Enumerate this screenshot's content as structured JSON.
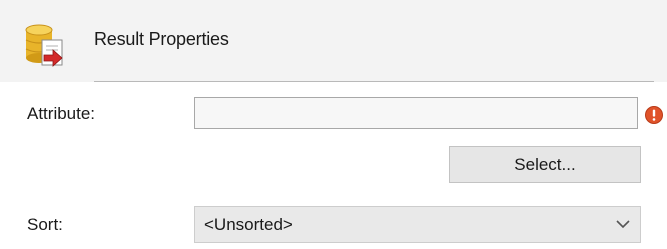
{
  "header": {
    "title": "Result Properties",
    "icon": "database-export-icon"
  },
  "fields": {
    "attribute": {
      "label": "Attribute:",
      "value": "",
      "status_icon": "error-icon",
      "status_color": "#e0532a"
    },
    "select_button": {
      "label": "Select..."
    },
    "sort": {
      "label": "Sort:",
      "selected": "<Unsorted>"
    }
  }
}
